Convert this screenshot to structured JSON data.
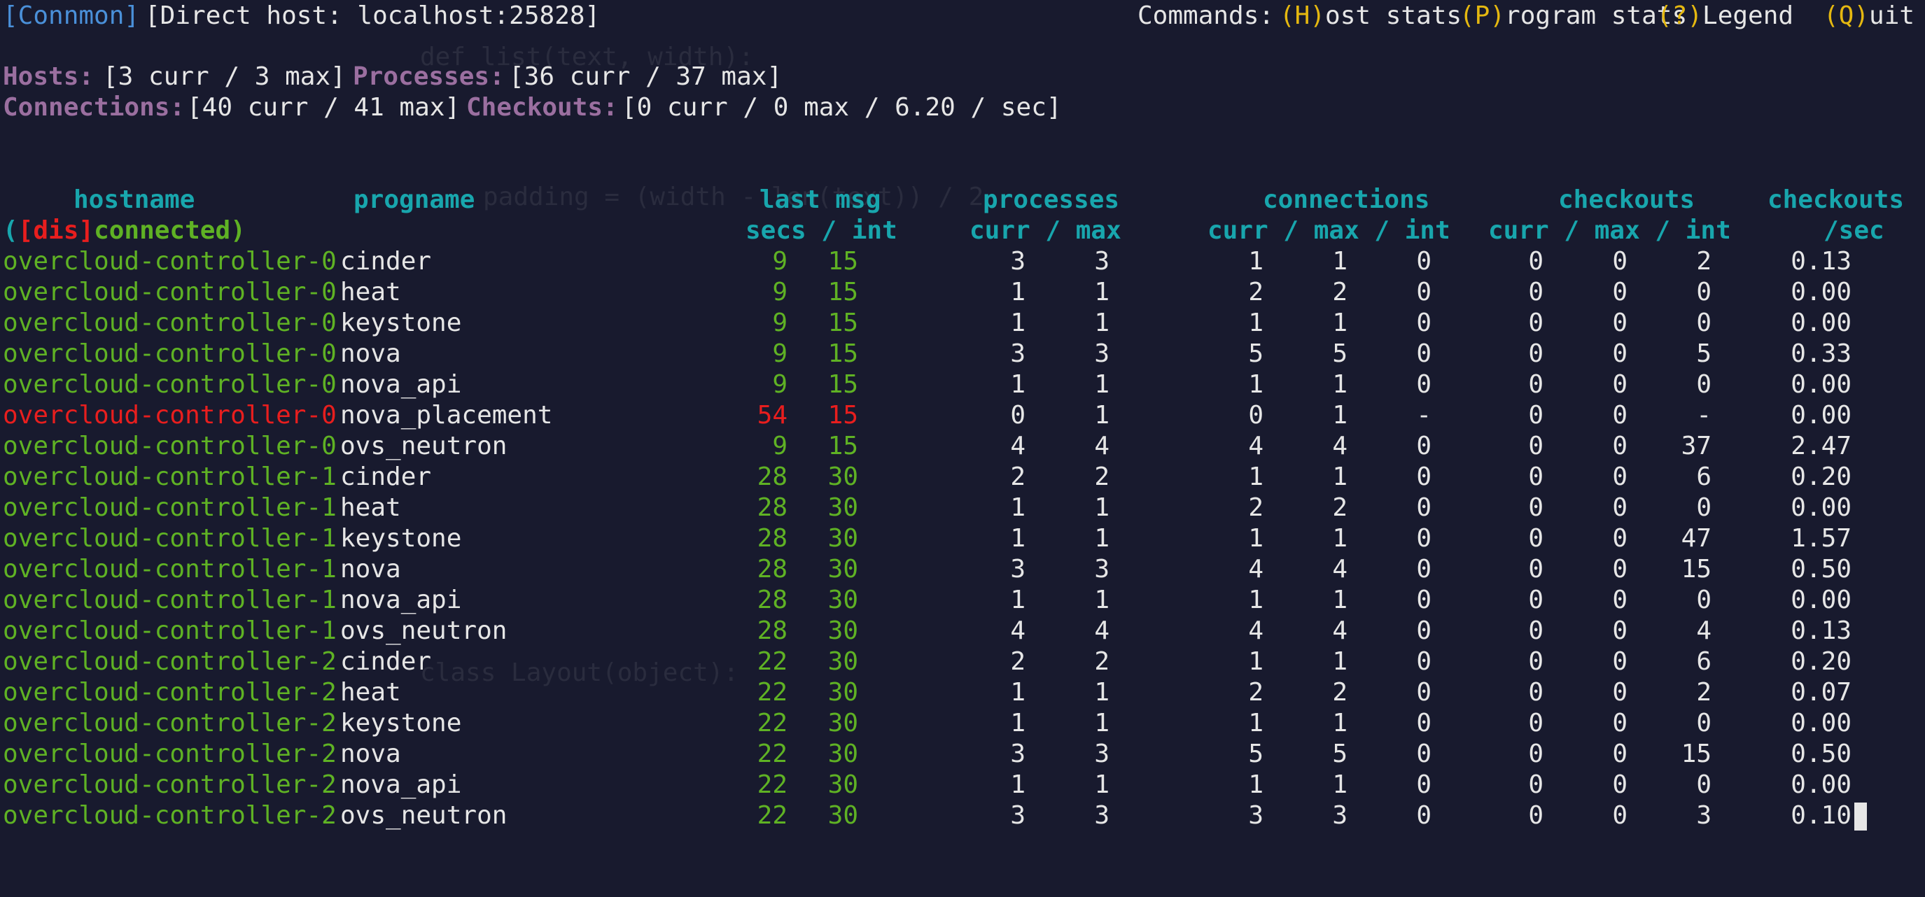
{
  "titlebar": {
    "app": "[Connmon]",
    "host": "[Direct host: localhost:25828]",
    "commands_label": "Commands:",
    "commands": [
      {
        "key": "(H)",
        "rest": "ost stats"
      },
      {
        "key": "(P)",
        "rest": "rogram stats"
      },
      {
        "key": "(?)",
        "rest": "Legend"
      },
      {
        "key": "(Q)",
        "rest": "uit"
      }
    ]
  },
  "summary": {
    "hosts_label": "Hosts:",
    "hosts_value": "[3 curr / 3 max]",
    "processes_label": "Processes:",
    "processes_value": "[36 curr / 37 max]",
    "connections_label": "Connections:",
    "connections_value": "[40 curr / 41 max]",
    "checkouts_label": "Checkouts:",
    "checkouts_value": "[0 curr / 0 max / 6.20 / sec]"
  },
  "header": {
    "hostname": "hostname",
    "progname": "progname",
    "last_msg": "last msg",
    "processes": "processes",
    "connections": "connections",
    "checkouts": "checkouts",
    "checkouts_sec": "checkouts",
    "dis_open": "(",
    "dis_mid": "[dis]",
    "dis_close": "connected)",
    "secs_int": "secs / int",
    "curr_max": "curr / max",
    "curr_max_int": "curr / max / int",
    "curr_max_int2": "curr / max / int",
    "per_sec": "/sec"
  },
  "colors": {
    "background": "#181a2e",
    "connected": "#5fb224",
    "disconnected": "#e81e1e",
    "header": "#18a6ad",
    "label": "#9b6fa0",
    "command_key": "#e5b810",
    "app_title": "#4a90d9"
  },
  "rows": [
    {
      "host": "overcloud-controller-0",
      "prog": "cinder",
      "secs": "9",
      "int": "15",
      "p_curr": "3",
      "p_max": "3",
      "c_curr": "1",
      "c_max": "1",
      "c_int": "0",
      "k_curr": "0",
      "k_max": "0",
      "k_int": "2",
      "rate": "0.13",
      "status": "connected"
    },
    {
      "host": "overcloud-controller-0",
      "prog": "heat",
      "secs": "9",
      "int": "15",
      "p_curr": "1",
      "p_max": "1",
      "c_curr": "2",
      "c_max": "2",
      "c_int": "0",
      "k_curr": "0",
      "k_max": "0",
      "k_int": "0",
      "rate": "0.00",
      "status": "connected"
    },
    {
      "host": "overcloud-controller-0",
      "prog": "keystone",
      "secs": "9",
      "int": "15",
      "p_curr": "1",
      "p_max": "1",
      "c_curr": "1",
      "c_max": "1",
      "c_int": "0",
      "k_curr": "0",
      "k_max": "0",
      "k_int": "0",
      "rate": "0.00",
      "status": "connected"
    },
    {
      "host": "overcloud-controller-0",
      "prog": "nova",
      "secs": "9",
      "int": "15",
      "p_curr": "3",
      "p_max": "3",
      "c_curr": "5",
      "c_max": "5",
      "c_int": "0",
      "k_curr": "0",
      "k_max": "0",
      "k_int": "5",
      "rate": "0.33",
      "status": "connected"
    },
    {
      "host": "overcloud-controller-0",
      "prog": "nova_api",
      "secs": "9",
      "int": "15",
      "p_curr": "1",
      "p_max": "1",
      "c_curr": "1",
      "c_max": "1",
      "c_int": "0",
      "k_curr": "0",
      "k_max": "0",
      "k_int": "0",
      "rate": "0.00",
      "status": "connected"
    },
    {
      "host": "overcloud-controller-0",
      "prog": "nova_placement",
      "secs": "54",
      "int": "15",
      "p_curr": "0",
      "p_max": "1",
      "c_curr": "0",
      "c_max": "1",
      "c_int": "-",
      "k_curr": "0",
      "k_max": "0",
      "k_int": "-",
      "rate": "0.00",
      "status": "disconnected"
    },
    {
      "host": "overcloud-controller-0",
      "prog": "ovs_neutron",
      "secs": "9",
      "int": "15",
      "p_curr": "4",
      "p_max": "4",
      "c_curr": "4",
      "c_max": "4",
      "c_int": "0",
      "k_curr": "0",
      "k_max": "0",
      "k_int": "37",
      "rate": "2.47",
      "status": "connected"
    },
    {
      "host": "overcloud-controller-1",
      "prog": "cinder",
      "secs": "28",
      "int": "30",
      "p_curr": "2",
      "p_max": "2",
      "c_curr": "1",
      "c_max": "1",
      "c_int": "0",
      "k_curr": "0",
      "k_max": "0",
      "k_int": "6",
      "rate": "0.20",
      "status": "connected"
    },
    {
      "host": "overcloud-controller-1",
      "prog": "heat",
      "secs": "28",
      "int": "30",
      "p_curr": "1",
      "p_max": "1",
      "c_curr": "2",
      "c_max": "2",
      "c_int": "0",
      "k_curr": "0",
      "k_max": "0",
      "k_int": "0",
      "rate": "0.00",
      "status": "connected"
    },
    {
      "host": "overcloud-controller-1",
      "prog": "keystone",
      "secs": "28",
      "int": "30",
      "p_curr": "1",
      "p_max": "1",
      "c_curr": "1",
      "c_max": "1",
      "c_int": "0",
      "k_curr": "0",
      "k_max": "0",
      "k_int": "47",
      "rate": "1.57",
      "status": "connected"
    },
    {
      "host": "overcloud-controller-1",
      "prog": "nova",
      "secs": "28",
      "int": "30",
      "p_curr": "3",
      "p_max": "3",
      "c_curr": "4",
      "c_max": "4",
      "c_int": "0",
      "k_curr": "0",
      "k_max": "0",
      "k_int": "15",
      "rate": "0.50",
      "status": "connected"
    },
    {
      "host": "overcloud-controller-1",
      "prog": "nova_api",
      "secs": "28",
      "int": "30",
      "p_curr": "1",
      "p_max": "1",
      "c_curr": "1",
      "c_max": "1",
      "c_int": "0",
      "k_curr": "0",
      "k_max": "0",
      "k_int": "0",
      "rate": "0.00",
      "status": "connected"
    },
    {
      "host": "overcloud-controller-1",
      "prog": "ovs_neutron",
      "secs": "28",
      "int": "30",
      "p_curr": "4",
      "p_max": "4",
      "c_curr": "4",
      "c_max": "4",
      "c_int": "0",
      "k_curr": "0",
      "k_max": "0",
      "k_int": "4",
      "rate": "0.13",
      "status": "connected"
    },
    {
      "host": "overcloud-controller-2",
      "prog": "cinder",
      "secs": "22",
      "int": "30",
      "p_curr": "2",
      "p_max": "2",
      "c_curr": "1",
      "c_max": "1",
      "c_int": "0",
      "k_curr": "0",
      "k_max": "0",
      "k_int": "6",
      "rate": "0.20",
      "status": "connected"
    },
    {
      "host": "overcloud-controller-2",
      "prog": "heat",
      "secs": "22",
      "int": "30",
      "p_curr": "1",
      "p_max": "1",
      "c_curr": "2",
      "c_max": "2",
      "c_int": "0",
      "k_curr": "0",
      "k_max": "0",
      "k_int": "2",
      "rate": "0.07",
      "status": "connected"
    },
    {
      "host": "overcloud-controller-2",
      "prog": "keystone",
      "secs": "22",
      "int": "30",
      "p_curr": "1",
      "p_max": "1",
      "c_curr": "1",
      "c_max": "1",
      "c_int": "0",
      "k_curr": "0",
      "k_max": "0",
      "k_int": "0",
      "rate": "0.00",
      "status": "connected"
    },
    {
      "host": "overcloud-controller-2",
      "prog": "nova",
      "secs": "22",
      "int": "30",
      "p_curr": "3",
      "p_max": "3",
      "c_curr": "5",
      "c_max": "5",
      "c_int": "0",
      "k_curr": "0",
      "k_max": "0",
      "k_int": "15",
      "rate": "0.50",
      "status": "connected"
    },
    {
      "host": "overcloud-controller-2",
      "prog": "nova_api",
      "secs": "22",
      "int": "30",
      "p_curr": "1",
      "p_max": "1",
      "c_curr": "1",
      "c_max": "1",
      "c_int": "0",
      "k_curr": "0",
      "k_max": "0",
      "k_int": "0",
      "rate": "0.00",
      "status": "connected"
    },
    {
      "host": "overcloud-controller-2",
      "prog": "ovs_neutron",
      "secs": "22",
      "int": "30",
      "p_curr": "3",
      "p_max": "3",
      "c_curr": "3",
      "c_max": "3",
      "c_int": "0",
      "k_curr": "0",
      "k_max": "0",
      "k_int": "3",
      "rate": "0.10",
      "status": "connected"
    }
  ]
}
